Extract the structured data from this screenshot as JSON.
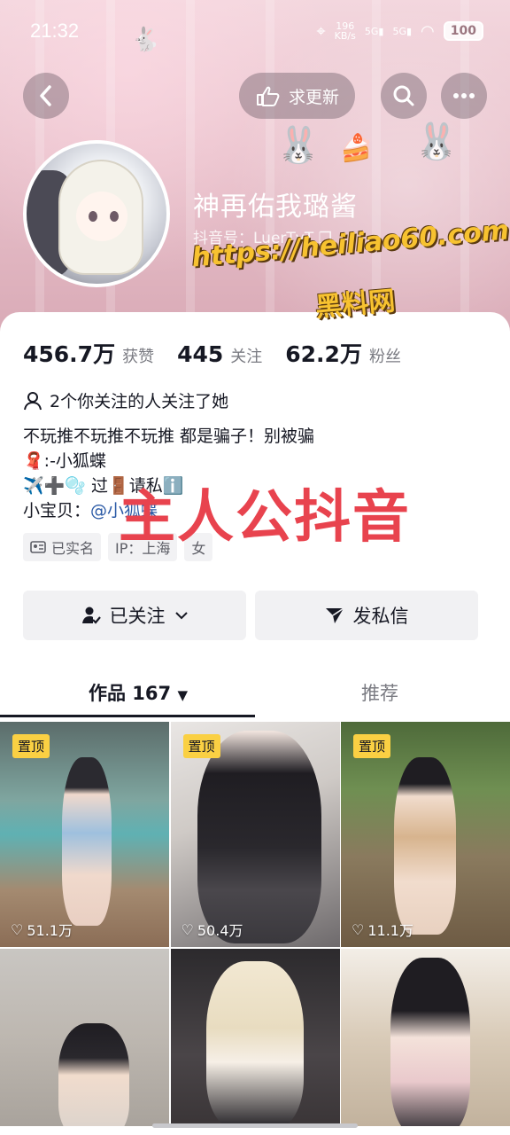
{
  "status_bar": {
    "time": "21:32",
    "net_speed": "196",
    "net_unit": "KB/s",
    "signal1": "5G",
    "signal2": "5G",
    "battery": "100"
  },
  "top_actions": {
    "request_update_label": "求更新"
  },
  "profile": {
    "nickname": "神再佑我璐酱",
    "douyin_id": "抖音号：LuerTvT"
  },
  "stats": [
    {
      "value": "456.7万",
      "label": "获赞"
    },
    {
      "value": "445",
      "label": "关注"
    },
    {
      "value": "62.2万",
      "label": "粉丝"
    }
  ],
  "mutual_follow": "2个你关注的人关注了她",
  "bio": {
    "line1": "不玩推不玩推不玩推 都是骗子！别被骗",
    "line2_emoji": "🧣",
    "line2_text": ":-小狐蝶",
    "line3_emoji": "✈️➕🫧",
    "line3_text": "过🚪请私ℹ️",
    "line4_prefix": "小宝贝：",
    "line4_mention": "@小狐蝶"
  },
  "tags": [
    {
      "icon": "id-card-icon",
      "label": "已实名"
    },
    {
      "icon": "",
      "label": "IP：上海"
    },
    {
      "icon": "",
      "label": "女"
    }
  ],
  "actions": {
    "followed_label": "已关注",
    "message_label": "发私信"
  },
  "tabs": {
    "works_label": "作品 167",
    "recommend_label": "推荐"
  },
  "videos": [
    {
      "pinned": "置顶",
      "likes": "51.1万"
    },
    {
      "pinned": "置顶",
      "likes": "50.4万"
    },
    {
      "pinned": "置顶",
      "likes": "11.1万"
    },
    {
      "pinned": "",
      "likes": ""
    },
    {
      "pinned": "",
      "likes": ""
    },
    {
      "pinned": "",
      "likes": ""
    }
  ],
  "watermarks": {
    "url": "https://heiliao60.com",
    "site": "黑料网",
    "overlay": "主人公抖音"
  },
  "colors": {
    "pin_badge": "#fad043",
    "mention": "#2b5aa6",
    "overlay_text": "#e8434e",
    "watermark_yellow": "#f7c230"
  }
}
